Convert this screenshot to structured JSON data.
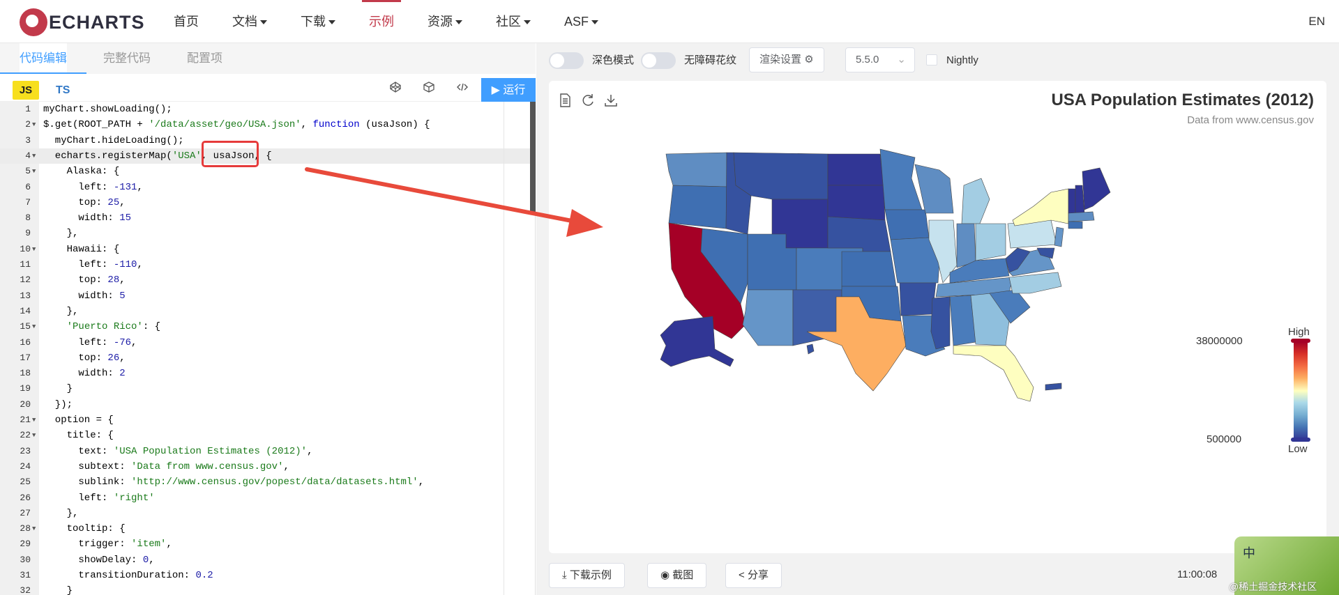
{
  "topnav": {
    "logo": "ECHARTS",
    "items": [
      "首页",
      "文档",
      "下载",
      "示例",
      "资源",
      "社区",
      "ASF"
    ],
    "active": "示例",
    "lang": "EN"
  },
  "editor": {
    "tabs": [
      "代码编辑",
      "完整代码",
      "配置项"
    ],
    "active_tab": "代码编辑",
    "js_label": "JS",
    "ts_label": "TS",
    "run_label": "运行",
    "lines": [
      "myChart.showLoading();",
      "$.get(ROOT_PATH + '/data/asset/geo/USA.json', function (usaJson) {",
      "  myChart.hideLoading();",
      "  echarts.registerMap('USA', usaJson, {",
      "    Alaska: {",
      "      left: -131,",
      "      top: 25,",
      "      width: 15",
      "    },",
      "    Hawaii: {",
      "      left: -110,",
      "      top: 28,",
      "      width: 5",
      "    },",
      "    'Puerto Rico': {",
      "      left: -76,",
      "      top: 26,",
      "      width: 2",
      "    }",
      "  });",
      "  option = {",
      "    title: {",
      "      text: 'USA Population Estimates (2012)',",
      "      subtext: 'Data from www.census.gov',",
      "      sublink: 'http://www.census.gov/popest/data/datasets.html',",
      "      left: 'right'",
      "    },",
      "    tooltip: {",
      "      trigger: 'item',",
      "      showDelay: 0,",
      "      transitionDuration: 0.2",
      "    }"
    ]
  },
  "toolbar": {
    "dark_mode": "深色模式",
    "a11y": "无障碍花纹",
    "render_settings": "渲染设置",
    "version": "5.5.0",
    "nightly": "Nightly"
  },
  "chart": {
    "title": "USA Population Estimates (2012)",
    "subtitle": "Data from www.census.gov",
    "visual_map": {
      "high": "High",
      "low": "Low",
      "max": "38000000",
      "min": "500000"
    },
    "colors": {
      "high": "#a50026",
      "low": "#313695",
      "mid": "#ffffbf"
    }
  },
  "bottom": {
    "download": "下载示例",
    "screenshot": "截图",
    "share": "分享",
    "time": "11:00:08"
  },
  "watermark": {
    "char": "中",
    "text": "@稀土掘金技术社区"
  }
}
